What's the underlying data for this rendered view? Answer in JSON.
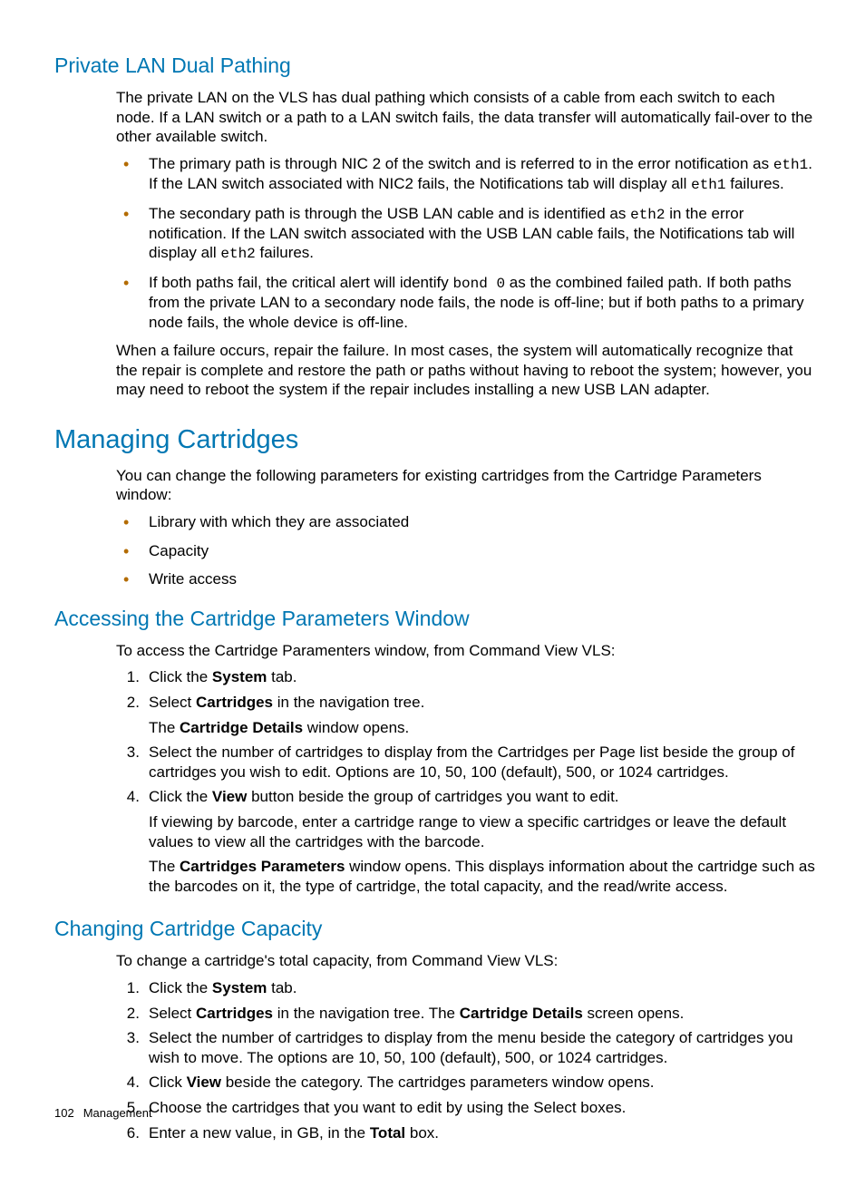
{
  "sec1": {
    "title": "Private LAN Dual Pathing",
    "intro": "The private LAN on the VLS has dual pathing which consists of a cable from each switch to each node. If a LAN switch or a path to a LAN switch fails, the data transfer will automatically fail-over to the other available switch.",
    "b1a": "The primary path is through NIC 2 of the switch and is referred to in the error notification as ",
    "b1code1": "eth1",
    "b1b": ". If the LAN switch associated with NIC2 fails, the Notifications tab will display all ",
    "b1code2": "eth1",
    "b1c": " failures.",
    "b2a": "The secondary path is through the USB LAN cable and is identified as ",
    "b2code1": "eth2",
    "b2b": " in the error notification. If the LAN switch associated with the USB LAN cable fails, the Notifications tab will display all ",
    "b2code2": "eth2",
    "b2c": " failures.",
    "b3a": "If both paths fail, the critical alert will identify ",
    "b3code1": "bond 0",
    "b3b": " as the combined failed path. If both paths from the private LAN to a secondary node fails, the node is off-line; but if both paths to a primary node fails, the whole device is off-line.",
    "outro": "When a failure occurs, repair the failure. In most cases, the system will automatically recognize that the repair is complete and restore the path or paths without having to reboot the system; however, you may need to reboot the system if the repair includes installing a new USB LAN adapter."
  },
  "sec2": {
    "title": "Managing Cartridges",
    "intro": "You can change the following parameters for existing cartridges from the Cartridge Parameters window:",
    "b1": "Library with which they are associated",
    "b2": "Capacity",
    "b3": "Write access"
  },
  "sec3": {
    "title": "Accessing the Cartridge Parameters Window",
    "intro": "To access the Cartridge Paramenters window, from Command View VLS:",
    "s1a": "Click the ",
    "s1bold": "System",
    "s1b": " tab.",
    "s2a": "Select ",
    "s2bold": "Cartridges",
    "s2b": " in the navigation tree.",
    "s2suba": "The ",
    "s2subbold": "Cartridge Details",
    "s2subb": " window opens.",
    "s3": "Select the number of cartridges to display from the Cartridges per Page list beside the group of cartridges you wish to edit. Options are 10, 50, 100 (default), 500, or 1024 cartridges.",
    "s4a": "Click the ",
    "s4bold": "View",
    "s4b": " button beside the group of cartridges you want to edit.",
    "s4sub1": "If viewing by barcode, enter a cartridge range to view a specific cartridges or leave the default values to view all the cartridges with the barcode.",
    "s4sub2a": "The ",
    "s4sub2bold": "Cartridges Parameters",
    "s4sub2b": " window opens. This displays information about the cartridge such as the barcodes on it, the type of cartridge, the total capacity, and the read/write access."
  },
  "sec4": {
    "title": "Changing Cartridge Capacity",
    "intro": "To change a cartridge's total capacity, from Command View VLS:",
    "s1a": "Click the ",
    "s1bold": "System",
    "s1b": " tab.",
    "s2a": "Select ",
    "s2bold1": "Cartridges",
    "s2b": " in the navigation tree. The ",
    "s2bold2": "Cartridge Details",
    "s2c": " screen opens.",
    "s3": "Select the number of cartridges to display from the menu beside the category of cartridges you wish to move. The options are 10, 50, 100 (default), 500, or 1024 cartridges.",
    "s4a": "Click ",
    "s4bold": "View",
    "s4b": " beside the category. The cartridges parameters window opens.",
    "s5": "Choose the cartridges that you want to edit by using the Select boxes.",
    "s6a": "Enter a new value, in GB, in the ",
    "s6bold": "Total",
    "s6b": " box."
  },
  "footer": {
    "page": "102",
    "section": "Management"
  }
}
